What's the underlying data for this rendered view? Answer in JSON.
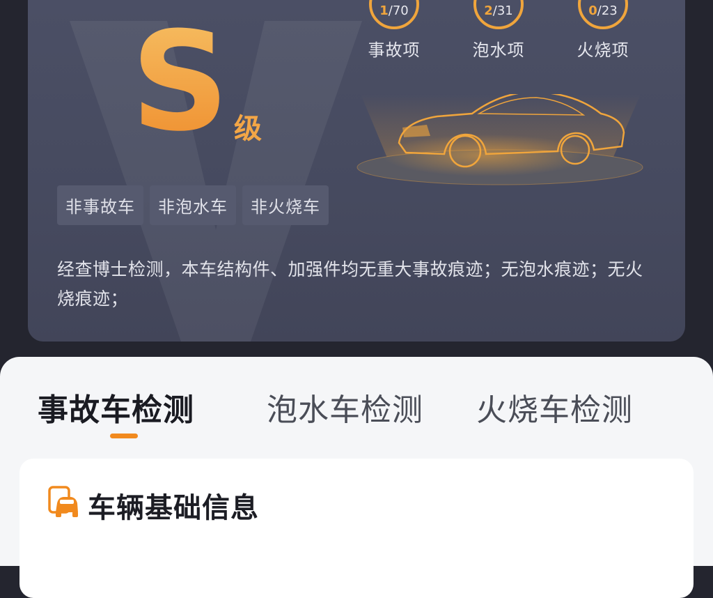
{
  "report": {
    "grade_letter": "S",
    "grade_suffix": "级",
    "stats": [
      {
        "hit": "1",
        "total": "/70",
        "label": "事故项"
      },
      {
        "hit": "2",
        "total": "/31",
        "label": "泡水项"
      },
      {
        "hit": "0",
        "total": "/23",
        "label": "火烧项"
      }
    ],
    "tags": [
      "非事故车",
      "非泡水车",
      "非火烧车"
    ],
    "summary": "经查博士检测，本车结构件、加强件均无重大事故痕迹；无泡水痕迹；无火烧痕迹；"
  },
  "tabs": [
    {
      "label": "事故车检测"
    },
    {
      "label": "泡水车检测"
    },
    {
      "label": "火烧车检测"
    }
  ],
  "active_tab": 0,
  "section": {
    "title": "车辆基础信息",
    "icon": "vehicle-doc-icon"
  },
  "colors": {
    "accent": "#f18a1e",
    "grade_gold": "#f3a646",
    "card_bg": "#4a4e63",
    "page_bg": "#24252f",
    "sheet_bg": "#f5f6f8"
  }
}
